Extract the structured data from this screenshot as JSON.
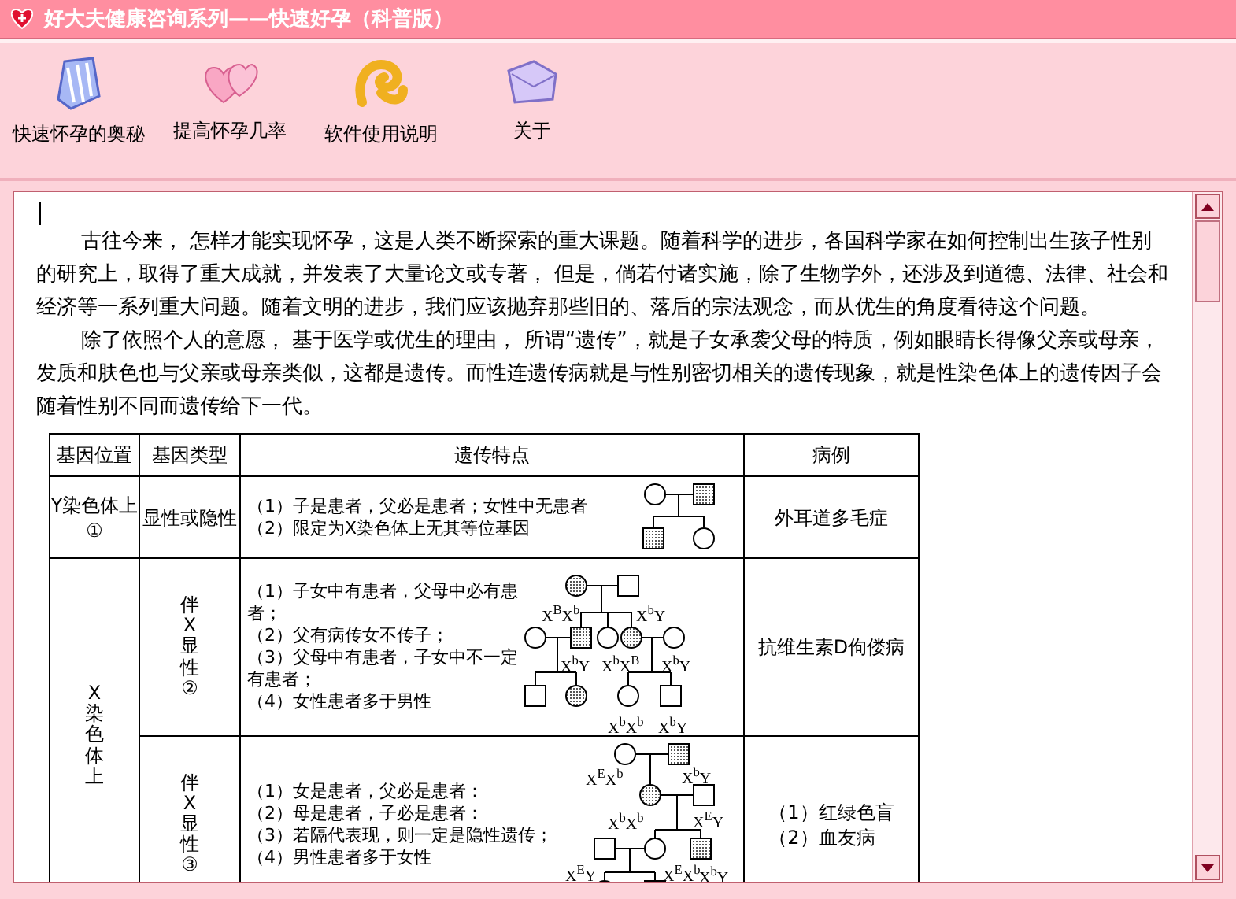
{
  "window": {
    "title": "好大夫健康咨询系列——快速好孕（科普版）"
  },
  "toolbar": [
    {
      "label": "快速怀孕的奥秘",
      "kind": "shell"
    },
    {
      "label": "提高怀孕几率",
      "kind": "hearts"
    },
    {
      "label": "软件使用说明",
      "kind": "swirl"
    },
    {
      "label": "关于",
      "kind": "wing"
    }
  ],
  "article": {
    "paragraphs": [
      "古往今来，  怎样才能实现怀孕，这是人类不断探索的重大课题。随着科学的进步，各国科学家在如何控制出生孩子性别的研究上，取得了重大成就，并发表了大量论文或专著，  但是，倘若付诸实施，除了生物学外，还涉及到道德、法律、社会和经济等一系列重大问题。随着文明的进步，我们应该抛弃那些旧的、落后的宗法观念，而从优生的角度看待这个问题。",
      "除了依照个人的意愿，  基于医学或优生的理由，  所谓“遗传”，就是子女承袭父母的特质，例如眼睛长得像父亲或母亲，发质和肤色也与父亲或母亲类似，这都是遗传。而性连遗传病就是与性别密切相关的遗传现象，就是性染色体上的遗传因子会随着性别不同而遗传给下一代。"
    ]
  },
  "table": {
    "columns": [
      "基因位置",
      "基因类型",
      "遗传特点",
      "病例"
    ],
    "groups": [
      {
        "location": "Y染色体上①",
        "vertical": false,
        "rows": [
          {
            "type": "显性或隐性",
            "vertical": false,
            "features": [
              "（1）子是患者，父必是患者；女性中无患者",
              "（2）限定为X染色体上无其等位基因"
            ],
            "pedigree": {
              "kind": "y_linked"
            },
            "examples": [
              "外耳道多毛症"
            ]
          }
        ]
      },
      {
        "location": "X染色体上",
        "vertical": true,
        "rows": [
          {
            "type": "伴X显性②",
            "vertical": true,
            "features": [
              "（1）子女中有患者，父母中必有患者；",
              "（2）父有病传女不传子；",
              "（3）父母中有患者，子女中不一定有患者；",
              "（4）女性患者多于男性"
            ],
            "pedigree": {
              "kind": "x_dominant",
              "labels": [
                "X$^{B}$X$^{b}$",
                "X$^{b}$Y",
                "X$^{b}$Y",
                "X$^{b}$X$^{B}$",
                "X$^{b}$Y",
                "X$^{b}$X$^{b}$",
                "X$^{b}$Y"
              ]
            },
            "examples": [
              "抗维生素D佝偻病"
            ]
          },
          {
            "type": "伴X显性③",
            "vertical": true,
            "features": [
              "（1）女是患者，父必是患者：",
              "（2）母是患者，子必是患者：",
              "（3）若隔代表现，则一定是隐性遗传；",
              "（4）男性患者多于女性"
            ],
            "pedigree": {
              "kind": "x_recessive",
              "labels": [
                "X$^{E}$X$^{b}$",
                "X$^{b}$Y",
                "X$^{b}$X$^{b}$",
                "X$^{E}$Y",
                "X$^{E}$Y",
                "X$^{E}$X$^{b}$",
                "X$^{b}$Y"
              ]
            },
            "examples": [
              "（1）红绿色盲",
              "（2）血友病"
            ]
          }
        ]
      }
    ]
  }
}
